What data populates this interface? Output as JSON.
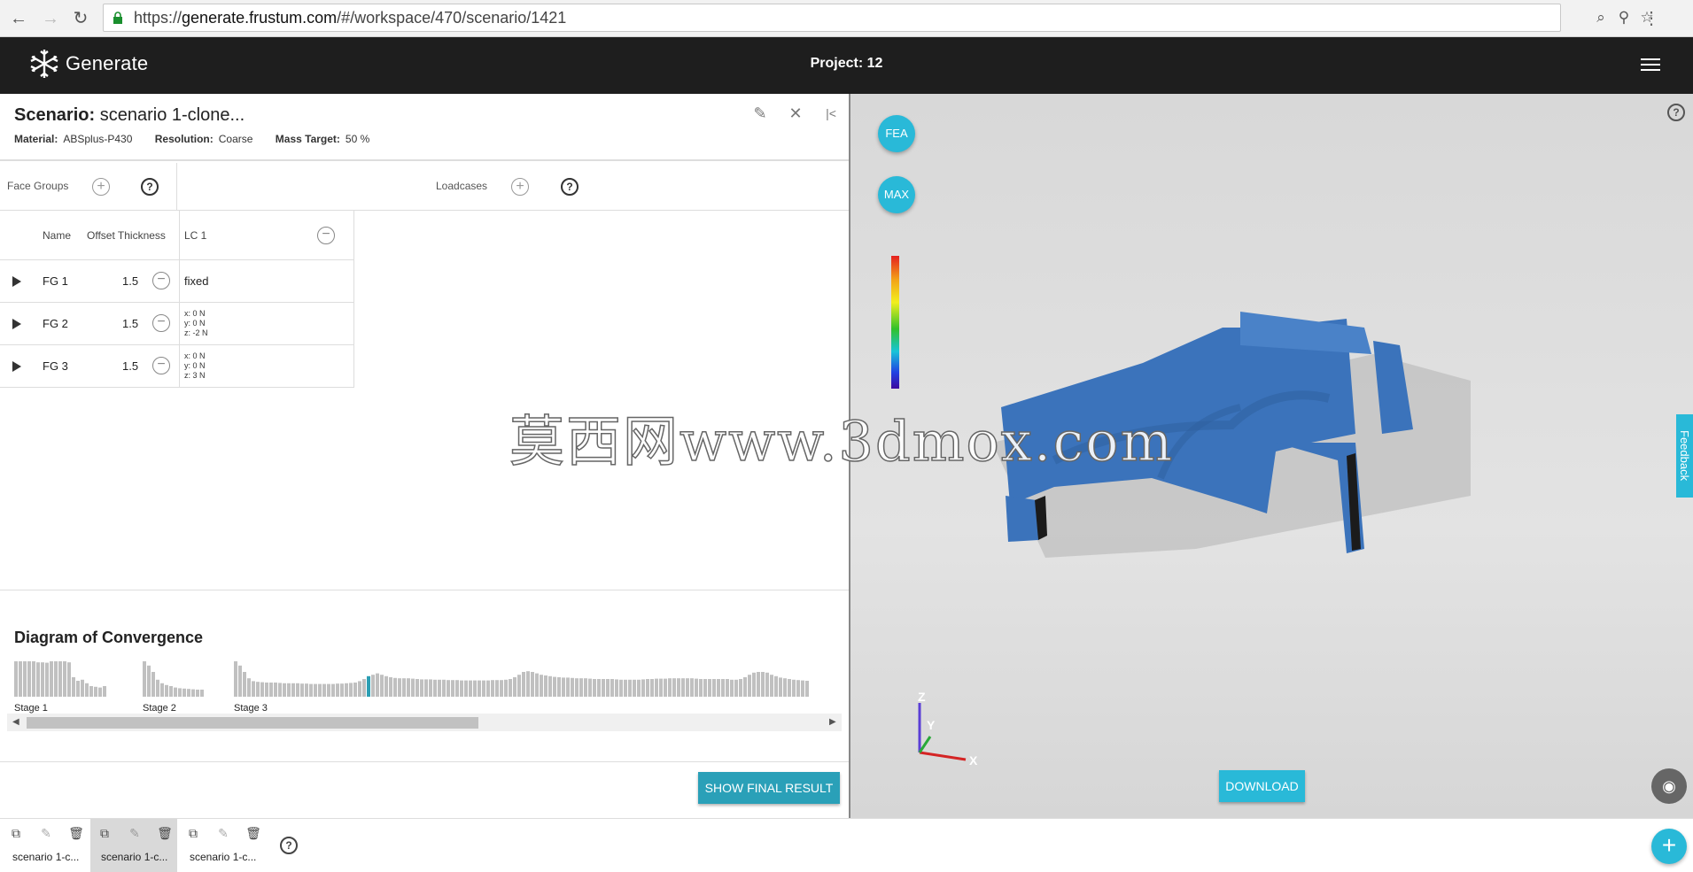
{
  "browser": {
    "url_scheme": "https://",
    "url_host": "generate.frustum.com",
    "url_path": "/#/workspace/470/scenario/1421"
  },
  "app": {
    "logo_text": "Generate",
    "project_title": "Project: 12"
  },
  "scenario": {
    "title_label": "Scenario:",
    "title_value": "scenario 1-clone...",
    "material_label": "Material:",
    "material_value": "ABSplus-P430",
    "resolution_label": "Resolution:",
    "resolution_value": "Coarse",
    "mass_label": "Mass Target:",
    "mass_value": "50 %"
  },
  "panels": {
    "face_groups_label": "Face Groups",
    "loadcases_label": "Loadcases",
    "help_glyph": "?"
  },
  "grid": {
    "headers": {
      "name": "Name",
      "offset": "Offset Thickness",
      "lc": "LC 1"
    },
    "rows": [
      {
        "name": "FG 1",
        "offset": "1.5",
        "load": "fixed",
        "fx": "",
        "fy": "",
        "fz": ""
      },
      {
        "name": "FG 2",
        "offset": "1.5",
        "load": "",
        "fx": "x: 0 N",
        "fy": "y: 0 N",
        "fz": "z: -2 N"
      },
      {
        "name": "FG 3",
        "offset": "1.5",
        "load": "",
        "fx": "x: 0 N",
        "fy": "y: 0 N",
        "fz": "z: 3 N"
      }
    ]
  },
  "convergence": {
    "title": "Diagram of Convergence",
    "stages": [
      "Stage 1",
      "Stage 2",
      "Stage 3"
    ],
    "stage1": [
      1.0,
      1.0,
      1.0,
      1.0,
      1.0,
      0.97,
      0.97,
      0.96,
      1.0,
      1.0,
      1.0,
      1.0,
      0.97,
      0.55,
      0.45,
      0.48,
      0.38,
      0.3,
      0.28,
      0.26,
      0.3
    ],
    "stage2": [
      1.0,
      0.88,
      0.7,
      0.48,
      0.38,
      0.33,
      0.3,
      0.26,
      0.24,
      0.23,
      0.22,
      0.21,
      0.2,
      0.2
    ],
    "stage3": [
      1.0,
      0.88,
      0.7,
      0.52,
      0.44,
      0.42,
      0.41,
      0.4,
      0.4,
      0.4,
      0.39,
      0.38,
      0.38,
      0.38,
      0.38,
      0.37,
      0.37,
      0.36,
      0.36,
      0.36,
      0.36,
      0.36,
      0.36,
      0.37,
      0.37,
      0.38,
      0.39,
      0.4,
      0.44,
      0.5,
      0.58,
      0.62,
      0.66,
      0.62,
      0.58,
      0.55,
      0.53,
      0.52,
      0.52,
      0.52,
      0.51,
      0.5,
      0.49,
      0.49,
      0.49,
      0.48,
      0.48,
      0.48,
      0.47,
      0.47,
      0.47,
      0.46,
      0.46,
      0.46,
      0.46,
      0.46,
      0.46,
      0.46,
      0.47,
      0.47,
      0.47,
      0.48,
      0.5,
      0.55,
      0.62,
      0.7,
      0.72,
      0.7,
      0.66,
      0.62,
      0.6,
      0.58,
      0.56,
      0.55,
      0.54,
      0.54,
      0.53,
      0.52,
      0.52,
      0.52,
      0.51,
      0.5,
      0.5,
      0.5,
      0.5,
      0.5,
      0.49,
      0.48,
      0.48,
      0.48,
      0.48,
      0.48,
      0.49,
      0.5,
      0.5,
      0.51,
      0.51,
      0.51,
      0.52,
      0.52,
      0.52,
      0.52,
      0.52,
      0.52,
      0.51,
      0.5,
      0.5,
      0.5,
      0.5,
      0.5,
      0.5,
      0.5,
      0.48,
      0.48,
      0.5,
      0.55,
      0.62,
      0.68,
      0.7,
      0.7,
      0.68,
      0.62,
      0.58,
      0.54,
      0.52,
      0.5,
      0.48,
      0.47,
      0.46,
      0.45
    ],
    "highlight_index": 30,
    "bar_color": "#c0c0c0",
    "highlight_color": "#2c9fb4"
  },
  "buttons": {
    "show_final": "SHOW FINAL RESULT",
    "download": "DOWNLOAD",
    "fea": "FEA",
    "max": "MAX",
    "feedback": "Feedback"
  },
  "axes": {
    "x": "X",
    "y": "Y",
    "z": "Z"
  },
  "watermark": "莫西网www.3dmox.com",
  "tabs": [
    {
      "label": "scenario 1-c..."
    },
    {
      "label": "scenario 1-c..."
    },
    {
      "label": "scenario 1-c..."
    }
  ],
  "colors": {
    "accent": "#29b9d8",
    "appbar": "#1e1e1e",
    "part": "#3b73bb",
    "active_tab": "#d9d9d9"
  }
}
